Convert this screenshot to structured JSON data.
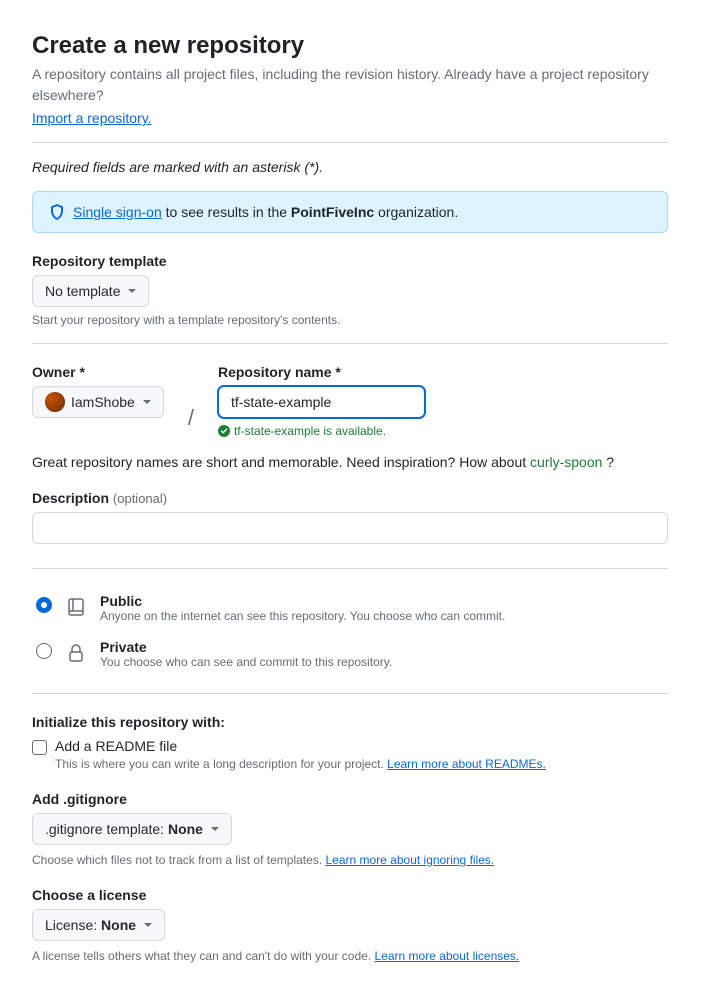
{
  "header": {
    "title": "Create a new repository",
    "subhead": "A repository contains all project files, including the revision history. Already have a project repository elsewhere?",
    "import_link": "Import a repository."
  },
  "required_note": "Required fields are marked with an asterisk (*).",
  "sso": {
    "link": "Single sign-on",
    "mid": " to see results in the ",
    "org": "PointFiveInc",
    "tail": " organization."
  },
  "template": {
    "label": "Repository template",
    "value": "No template",
    "hint": "Start your repository with a template repository's contents."
  },
  "owner": {
    "label": "Owner *",
    "value": "IamShobe"
  },
  "repo": {
    "label": "Repository name *",
    "value": "tf-state-example",
    "available_msg": "tf-state-example is available."
  },
  "name_hint": {
    "pre": "Great repository names are short and memorable. Need inspiration? How about ",
    "suggestion": "curly-spoon",
    "post": " ?"
  },
  "description": {
    "label": "Description",
    "optional": "(optional)",
    "value": ""
  },
  "visibility": {
    "public": {
      "title": "Public",
      "desc": "Anyone on the internet can see this repository. You choose who can commit."
    },
    "private": {
      "title": "Private",
      "desc": "You choose who can see and commit to this repository."
    }
  },
  "initialize": {
    "heading": "Initialize this repository with:",
    "readme": {
      "label": "Add a README file",
      "hint": "This is where you can write a long description for your project. ",
      "link": "Learn more about READMEs."
    },
    "gitignore": {
      "label": "Add .gitignore",
      "btn_prefix": ".gitignore template: ",
      "btn_value": "None",
      "hint": "Choose which files not to track from a list of templates. ",
      "link": "Learn more about ignoring files."
    },
    "license": {
      "label": "Choose a license",
      "btn_prefix": "License: ",
      "btn_value": "None",
      "hint": "A license tells others what they can and can't do with your code. ",
      "link": "Learn more about licenses."
    }
  }
}
